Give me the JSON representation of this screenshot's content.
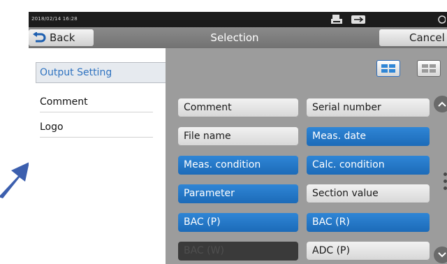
{
  "status_bar": {
    "datetime": "2018/02/14 16:28",
    "icons": [
      "printer-icon",
      "usb-icon"
    ]
  },
  "header": {
    "back_label": "Back",
    "title": "Selection",
    "cancel_label": "Cancel"
  },
  "sidebar": {
    "active_tab": "Output Setting",
    "items": [
      {
        "label": "Comment"
      },
      {
        "label": "Logo"
      }
    ]
  },
  "view_toggle": {
    "selected": "two-column"
  },
  "options": [
    {
      "label": "Comment",
      "state": "off"
    },
    {
      "label": "Serial number",
      "state": "off"
    },
    {
      "label": "File name",
      "state": "off"
    },
    {
      "label": "Meas. date",
      "state": "on"
    },
    {
      "label": "Meas. condition",
      "state": "on"
    },
    {
      "label": "Calc. condition",
      "state": "on"
    },
    {
      "label": "Parameter",
      "state": "on"
    },
    {
      "label": "Section value",
      "state": "off"
    },
    {
      "label": "BAC (P)",
      "state": "on"
    },
    {
      "label": "BAC (R)",
      "state": "on"
    },
    {
      "label": "BAC (W)",
      "state": "disabled"
    },
    {
      "label": "ADC (P)",
      "state": "off"
    }
  ],
  "colors": {
    "selected": "#1f72c2",
    "unselected": "#e2e2e2",
    "disabled": "#3a3a3a",
    "active_tab_text": "#2f73c0"
  }
}
